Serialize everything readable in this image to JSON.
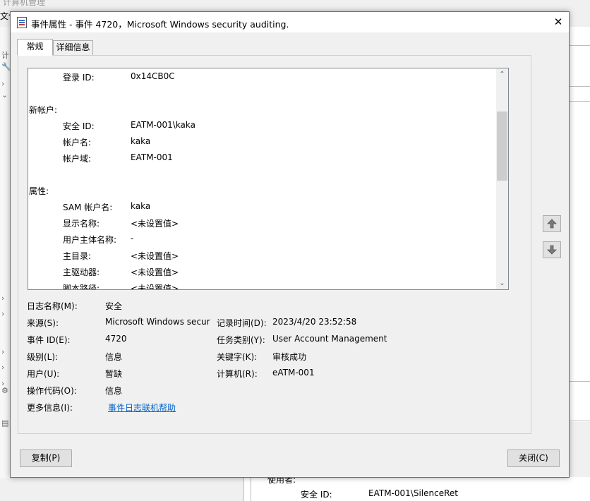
{
  "background": {
    "window_title": "计算机管理",
    "file_menu": "文件",
    "left_glyphs": [
      "计",
      "🔧",
      "›",
      "⌄",
      "›",
      "›",
      "›",
      "›",
      "›",
      "⚙",
      "▤"
    ],
    "bottom": {
      "used_by_label": "使用者:",
      "security_id_label": "安全 ID:",
      "security_id_value": "EATM-001\\SilenceRet"
    }
  },
  "dialog": {
    "title": "事件属性 - 事件 4720，Microsoft Windows security auditing.",
    "tabs": [
      {
        "label": "常规",
        "active": true
      },
      {
        "label": "详细信息",
        "active": false
      }
    ],
    "description_lines": [
      {
        "indent": 1,
        "label": "登录 ID:",
        "value": "0x14CB0C"
      },
      {
        "indent": 0,
        "label": "",
        "value": ""
      },
      {
        "indent": 0,
        "label": "新帐户:",
        "value": ""
      },
      {
        "indent": 1,
        "label": "安全 ID:",
        "value": "EATM-001\\kaka"
      },
      {
        "indent": 1,
        "label": "帐户名:",
        "value": "kaka"
      },
      {
        "indent": 1,
        "label": "帐户域:",
        "value": "EATM-001"
      },
      {
        "indent": 0,
        "label": "",
        "value": ""
      },
      {
        "indent": 0,
        "label": "属性:",
        "value": ""
      },
      {
        "indent": 1,
        "label": "SAM 帐户名:",
        "value": "kaka"
      },
      {
        "indent": 1,
        "label": "显示名称:",
        "value": "<未设置值>"
      },
      {
        "indent": 1,
        "label": "用户主体名称:",
        "value": "-"
      },
      {
        "indent": 1,
        "label": "主目录:",
        "value": "<未设置值>"
      },
      {
        "indent": 1,
        "label": "主驱动器:",
        "value": "<未设置值>"
      },
      {
        "indent": 1,
        "label": "脚本路径:",
        "value": "<未设置值>"
      }
    ],
    "fields": {
      "log_name_label": "日志名称(M):",
      "log_name_value": "安全",
      "source_label": "来源(S):",
      "source_value": "Microsoft Windows secur",
      "logged_label": "记录时间(D):",
      "logged_value": "2023/4/20 23:52:58",
      "event_id_label": "事件 ID(E):",
      "event_id_value": "4720",
      "task_category_label": "任务类别(Y):",
      "task_category_value": "User Account Management",
      "level_label": "级别(L):",
      "level_value": "信息",
      "keywords_label": "关键字(K):",
      "keywords_value": "审核成功",
      "user_label": "用户(U):",
      "user_value": "暂缺",
      "computer_label": "计算机(R):",
      "computer_value": "eATM-001",
      "opcode_label": "操作代码(O):",
      "opcode_value": "信息",
      "more_info_label": "更多信息(I):",
      "more_info_link": "事件日志联机帮助"
    },
    "buttons": {
      "copy": "复制(P)",
      "close": "关闭(C)"
    },
    "colors": {
      "link": "#0066cc",
      "scroll_thumb": "#cdcdcd"
    }
  }
}
